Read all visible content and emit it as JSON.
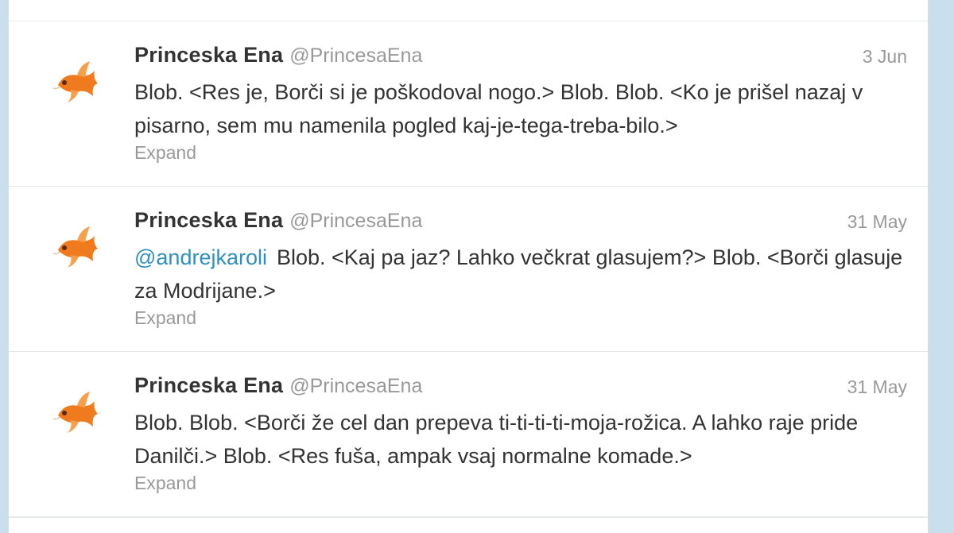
{
  "tweets": [
    {
      "name": "Princeska Ena",
      "handle": "@PrincesaEna",
      "time": "3 Jun",
      "mention": "",
      "text": "Blob. <Res je, Borči si je poškodoval nogo.> Blob. Blob. <Ko je prišel nazaj v pisarno, sem mu namenila pogled kaj-je-tega-treba-bilo.>",
      "expand": "Expand"
    },
    {
      "name": "Princeska Ena",
      "handle": "@PrincesaEna",
      "time": "31 May",
      "mention": "@andrejkaroli",
      "text": "Blob. <Kaj pa jaz? Lahko večkrat glasujem?> Blob. <Borči glasuje za Modrijane.>",
      "expand": "Expand"
    },
    {
      "name": "Princeska Ena",
      "handle": "@PrincesaEna",
      "time": "31 May",
      "mention": "",
      "text": "Blob. Blob. <Borči že cel dan prepeva ti-ti-ti-ti-moja-rožica. A lahko raje pride Danilči.> Blob. <Res fuša, ampak vsaj normalne komade.>",
      "expand": "Expand"
    }
  ],
  "colors": {
    "background": "#c9dfee",
    "name": "#333333",
    "muted": "#999999",
    "link": "#2f8fbf",
    "avatar_fish": "#f07a1e"
  },
  "icons": {
    "avatar": "goldfish-avatar-icon"
  }
}
